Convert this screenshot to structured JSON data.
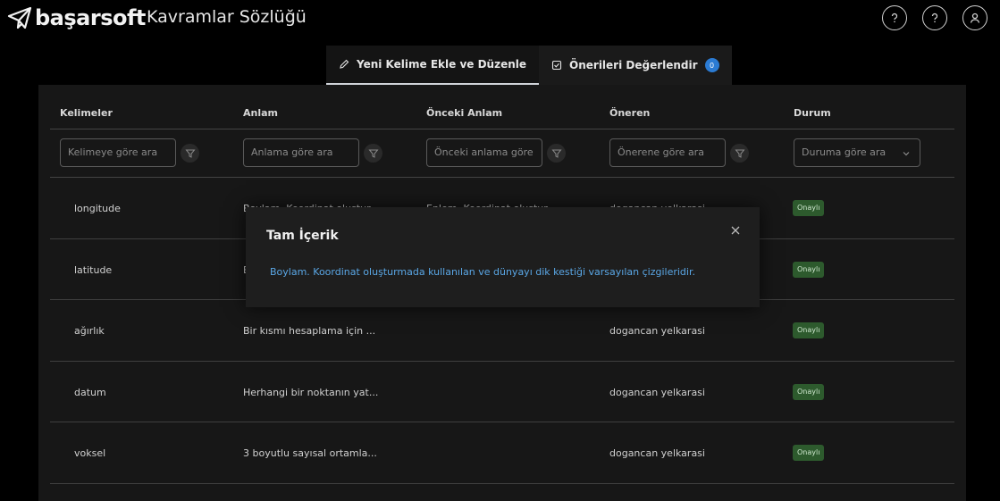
{
  "brand": {
    "name": "başarsoft"
  },
  "header": {
    "title": "Kavramlar Sözlüğü"
  },
  "header_icons": [
    "help-icon",
    "help-icon",
    "user-icon"
  ],
  "tabs": [
    {
      "label": "Yeni Kelime Ekle ve Düzenle",
      "icon": "pencil-icon",
      "active": true
    },
    {
      "label": "Önerileri Değerlendir",
      "icon": "checklist-icon",
      "badge": "0",
      "active": false
    }
  ],
  "table": {
    "columns": [
      "Kelimeler",
      "Anlam",
      "Önceki Anlam",
      "Öneren",
      "Durum"
    ],
    "filters": {
      "word": "Kelimeye göre ara",
      "meaning": "Anlama göre ara",
      "prev_meaning": "Önceki anlama göre",
      "proposer": "Önerene göre ara",
      "status": "Duruma göre ara"
    },
    "rows": [
      {
        "word": "longitude",
        "meaning": "Boylam. Koordinat oluştur...",
        "prev": "Enlem. Koordinat oluştur...",
        "proposer": "dogancan yelkarasi",
        "status": "Onaylı"
      },
      {
        "word": "latitude",
        "meaning": "E",
        "prev": "",
        "proposer": "",
        "status": "Onaylı"
      },
      {
        "word": "ağırlık",
        "meaning": "Bir kısmı hesaplama için ...",
        "prev": "",
        "proposer": "dogancan yelkarasi",
        "status": "Onaylı"
      },
      {
        "word": "datum",
        "meaning": "Herhangi bir noktanın yat...",
        "prev": "",
        "proposer": "dogancan yelkarasi",
        "status": "Onaylı"
      },
      {
        "word": "voksel",
        "meaning": "3 boyutlu sayısal ortamla...",
        "prev": "",
        "proposer": "dogancan yelkarasi",
        "status": "Onaylı"
      }
    ]
  },
  "modal": {
    "title": "Tam İçerik",
    "content": "Boylam. Koordinat oluşturmada kullanılan ve dünyayı dik kestiği varsayılan çizgileridir."
  },
  "colors": {
    "accent": "#2b7bd3",
    "status_green": "#2d5a2d",
    "link": "#5aa7e6"
  }
}
